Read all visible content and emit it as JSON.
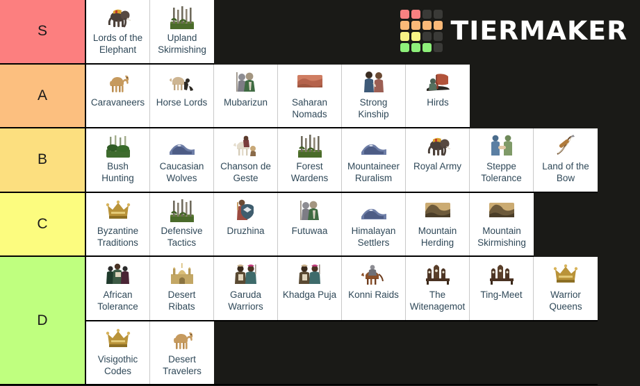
{
  "brand": {
    "name": "TIERMAKER",
    "logo_colors": {
      "red": "#f98080",
      "orange": "#fbb978",
      "yellow": "#f7f486",
      "green": "#8ef07a",
      "dark": "#3a3a37"
    },
    "logo_grid": [
      [
        "red",
        "red",
        "dark",
        "dark"
      ],
      [
        "orange",
        "orange",
        "orange",
        "orange"
      ],
      [
        "yellow",
        "yellow",
        "dark",
        "dark"
      ],
      [
        "green",
        "green",
        "green",
        "dark"
      ]
    ]
  },
  "background_color": "#1a1a17",
  "tiers": [
    {
      "label": "S",
      "color": "#fc7f7f",
      "rows": [
        [
          {
            "name": "Lords of the Elephant",
            "lines": [
              "Lords of the",
              "Elephant"
            ],
            "icon": "elephant-icon"
          },
          {
            "name": "Upland Skirmishing",
            "lines": [
              "Upland",
              "Skirmishing"
            ],
            "icon": "forest-icon"
          }
        ]
      ]
    },
    {
      "label": "A",
      "color": "#fcbf7f",
      "rows": [
        [
          {
            "name": "Caravaneers",
            "lines": [
              "Caravaneers"
            ],
            "icon": "camel-icon"
          },
          {
            "name": "Horse Lords",
            "lines": [
              "Horse Lords"
            ],
            "icon": "horse-hunt-icon"
          },
          {
            "name": "Mubarizun",
            "lines": [
              "Mubarizun"
            ],
            "icon": "warriors-icon"
          },
          {
            "name": "Saharan Nomads",
            "lines": [
              "Saharan",
              "Nomads"
            ],
            "icon": "desert-dune-icon"
          },
          {
            "name": "Strong Kinship",
            "lines": [
              "Strong",
              "Kinship"
            ],
            "icon": "two-people-icon"
          },
          {
            "name": "Hirds",
            "lines": [
              "Hirds"
            ],
            "icon": "longship-icon"
          }
        ]
      ]
    },
    {
      "label": "B",
      "color": "#fcdf7f",
      "rows": [
        [
          {
            "name": "Bush Hunting",
            "lines": [
              "Bush",
              "Hunting"
            ],
            "icon": "jungle-icon"
          },
          {
            "name": "Caucasian Wolves",
            "lines": [
              "Caucasian",
              "Wolves"
            ],
            "icon": "mountain-blue-icon"
          },
          {
            "name": "Chanson de Geste",
            "lines": [
              "Chanson de",
              "Geste"
            ],
            "icon": "knight-horse-icon"
          },
          {
            "name": "Forest Wardens",
            "lines": [
              "Forest",
              "Wardens"
            ],
            "icon": "forest-icon"
          },
          {
            "name": "Mountaineer Ruralism",
            "lines": [
              "Mountaineer",
              "Ruralism"
            ],
            "icon": "mountain-blue-icon"
          },
          {
            "name": "Royal Army",
            "lines": [
              "Royal Army"
            ],
            "icon": "elephant-icon"
          },
          {
            "name": "Steppe Tolerance",
            "lines": [
              "Steppe",
              "Tolerance"
            ],
            "icon": "handshake-icon"
          },
          {
            "name": "Land of the Bow",
            "lines": [
              "Land of the",
              "Bow"
            ],
            "icon": "bow-icon"
          }
        ]
      ]
    },
    {
      "label": "C",
      "color": "#fcfc7f",
      "rows": [
        [
          {
            "name": "Byzantine Traditions",
            "lines": [
              "Byzantine",
              "Traditions"
            ],
            "icon": "crown-icon"
          },
          {
            "name": "Defensive Tactics",
            "lines": [
              "Defensive",
              "Tactics"
            ],
            "icon": "forest-icon"
          },
          {
            "name": "Druzhina",
            "lines": [
              "Druzhina"
            ],
            "icon": "shield-warrior-icon"
          },
          {
            "name": "Futuwaa",
            "lines": [
              "Futuwaa"
            ],
            "icon": "warriors-icon"
          },
          {
            "name": "Himalayan Settlers",
            "lines": [
              "Himalayan",
              "Settlers"
            ],
            "icon": "mountain-blue-icon"
          },
          {
            "name": "Mountain Herding",
            "lines": [
              "Mountain",
              "Herding"
            ],
            "icon": "mountain-tan-icon"
          },
          {
            "name": "Mountain Skirmishing",
            "lines": [
              "Mountain",
              "Skirmishing"
            ],
            "icon": "mountain-tan-icon"
          }
        ]
      ]
    },
    {
      "label": "D",
      "color": "#bfff7f",
      "rows": [
        [
          {
            "name": "African Tolerance",
            "lines": [
              "African",
              "Tolerance"
            ],
            "icon": "people-group-icon"
          },
          {
            "name": "Desert Ribats",
            "lines": [
              "Desert",
              "Ribats"
            ],
            "icon": "mosque-icon"
          },
          {
            "name": "Garuda Warriors",
            "lines": [
              "Garuda",
              "Warriors"
            ],
            "icon": "turban-warriors-icon"
          },
          {
            "name": "Khadga Puja",
            "lines": [
              "Khadga Puja"
            ],
            "icon": "turban-warriors-icon"
          },
          {
            "name": "Konni Raids",
            "lines": [
              "Konni Raids"
            ],
            "icon": "horseman-icon"
          },
          {
            "name": "The Witenagemot",
            "lines": [
              "The",
              "Witenagemot"
            ],
            "icon": "thrones-icon"
          },
          {
            "name": "Ting-Meet",
            "lines": [
              "Ting-Meet"
            ],
            "icon": "thrones-icon"
          },
          {
            "name": "Warrior Queens",
            "lines": [
              "Warrior",
              "Queens"
            ],
            "icon": "crown-icon"
          }
        ],
        [
          {
            "name": "Visigothic Codes",
            "lines": [
              "Visigothic",
              "Codes"
            ],
            "icon": "crown-icon"
          },
          {
            "name": "Desert Travelers",
            "lines": [
              "Desert",
              "Travelers"
            ],
            "icon": "camel-icon"
          }
        ]
      ]
    }
  ]
}
